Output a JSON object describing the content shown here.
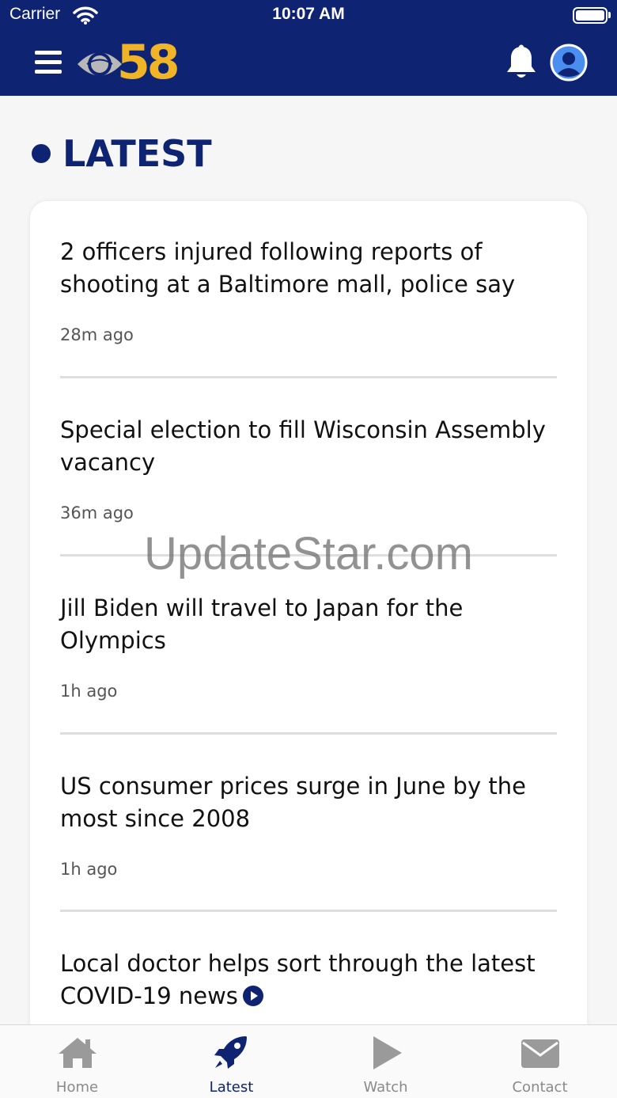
{
  "status_bar": {
    "carrier": "Carrier",
    "time": "10:07 AM"
  },
  "header": {
    "logo_number": "58",
    "menu_icon": "hamburger-menu-icon",
    "bell_icon": "bell-icon",
    "account_icon": "account-icon",
    "brand_color": "#0f2373",
    "logo_accent": "#f0b429"
  },
  "section": {
    "title": "LATEST"
  },
  "articles": [
    {
      "headline": "2 officers injured following reports of shooting at a Baltimore mall, police say",
      "ago": "28m ago"
    },
    {
      "headline": "Special election to fill Wisconsin Assembly vacancy",
      "ago": "36m ago"
    },
    {
      "headline": "Jill Biden will travel to Japan for the Olympics",
      "ago": "1h ago"
    },
    {
      "headline": "US consumer prices surge in June by the most since 2008",
      "ago": "1h ago"
    },
    {
      "headline": "Local doctor helps sort through the latest COVID-19 news",
      "has_video": true
    }
  ],
  "watermark": "UpdateStar.com",
  "tabs": [
    {
      "label": "Home",
      "icon": "home-icon"
    },
    {
      "label": "Latest",
      "icon": "rocket-icon",
      "active": true
    },
    {
      "label": "Watch",
      "icon": "play-icon"
    },
    {
      "label": "Contact",
      "icon": "envelope-icon"
    }
  ]
}
